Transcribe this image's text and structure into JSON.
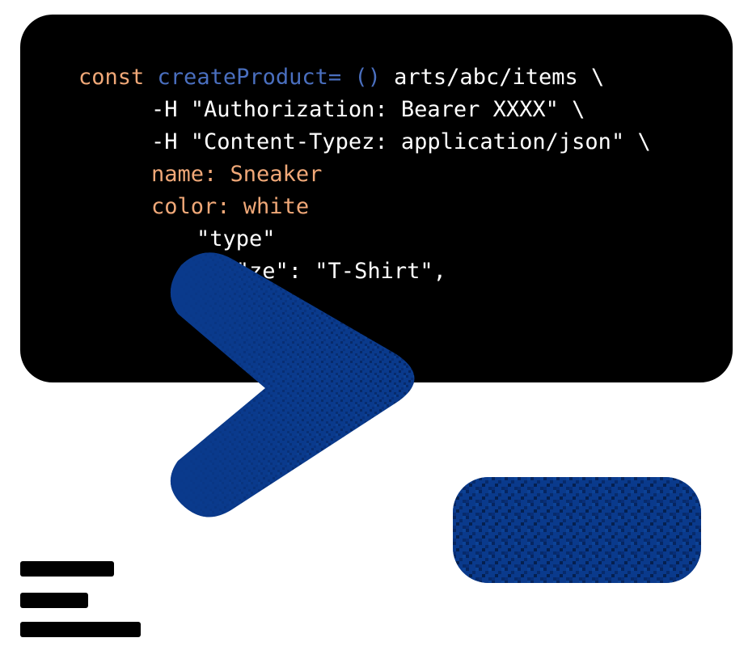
{
  "code": {
    "lines": [
      {
        "tokens": [
          {
            "text": "const ",
            "kind": "kw"
          },
          {
            "text": "createProduct= () ",
            "kind": "fn"
          },
          {
            "text": "arts/abc/items \\",
            "kind": "txt"
          }
        ]
      },
      {
        "tokens": [
          {
            "text": "-H \"Authorization: Bearer XXXX\" \\",
            "kind": "txt"
          }
        ]
      },
      {
        "tokens": [
          {
            "text": "-H \"Content-Typez: application/json\" \\",
            "kind": "txt"
          }
        ]
      },
      {
        "tokens": [
          {
            "text": "name: ",
            "kind": "key"
          },
          {
            "text": "Sneaker",
            "kind": "key"
          }
        ]
      },
      {
        "tokens": [
          {
            "text": "color: ",
            "kind": "key"
          },
          {
            "text": "white",
            "kind": "key"
          }
        ]
      },
      {
        "tokens": [
          {
            "text": "\"type\"",
            "kind": "txt"
          }
        ]
      },
      {
        "tokens": [
          {
            "text": "   \"ze\": \"T-Shirt\",",
            "kind": "txt"
          }
        ]
      }
    ]
  },
  "colors": {
    "panel": "#000000",
    "keyword": "#f0a878",
    "function": "#4a6fbf",
    "text": "#ffffff",
    "accent_blue": "#0a3a8c",
    "accent_blue_dark": "#06255f"
  },
  "icons": {
    "chevron": "chevron-right-icon",
    "pill": "blue-pill-shape",
    "legend": "text-lines-icon"
  }
}
